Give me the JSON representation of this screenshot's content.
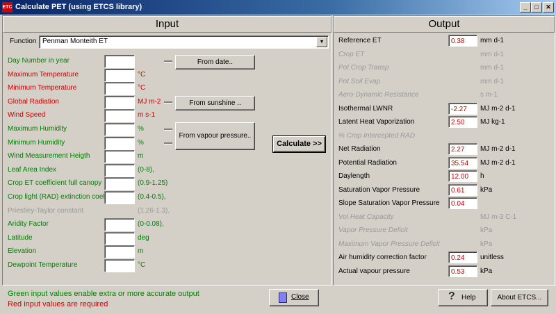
{
  "window": {
    "title": "Calculate PET (using ETCS library)",
    "icon_text": "ETC"
  },
  "input": {
    "header": "Input",
    "function_label": "Function",
    "function_value": "Penman Monteith ET",
    "rows": [
      {
        "label": "Day Number in year",
        "color": "#008000",
        "unit": ""
      },
      {
        "label": "Maximum Temperature",
        "color": "#cc0000",
        "unit": "°C"
      },
      {
        "label": "Minimum Temperature",
        "color": "#cc0000",
        "unit": "°C"
      },
      {
        "label": "Global Radiation",
        "color": "#cc0000",
        "unit": "MJ m-2"
      },
      {
        "label": "Wind Speed",
        "color": "#cc0000",
        "unit": "m s-1"
      },
      {
        "label": "Maximum Humidity",
        "color": "#008000",
        "unit": "%"
      },
      {
        "label": "Minimum Humidity",
        "color": "#008000",
        "unit": "%"
      },
      {
        "label": "Wind Measurement Heigth",
        "color": "#008000",
        "unit": "m"
      },
      {
        "label": "Leaf Area Index",
        "color": "#008000",
        "unit": "(0-8),"
      },
      {
        "label": "Crop ET coefficient full canopy",
        "color": "#008000",
        "unit": "(0.9-1.25)"
      },
      {
        "label": "Crop light (RAD) extinction coeff",
        "color": "#008000",
        "unit": "(0.4-0.5),"
      },
      {
        "label": "Priestley-Taylor constant",
        "color": "#999999",
        "unit": "(1.26-1.3),"
      },
      {
        "label": "Aridity Factor",
        "color": "#008000",
        "unit": "(0-0.08),"
      },
      {
        "label": "Latitude",
        "color": "#008000",
        "unit": "deg"
      },
      {
        "label": "Elevation",
        "color": "#008000",
        "unit": "m"
      },
      {
        "label": "Dewpoint Temperature",
        "color": "#008000",
        "unit": "°C"
      }
    ],
    "buttons": {
      "from_date": "From date..",
      "from_sunshine": "From sunshine ..",
      "from_vapour": "From vapour pressure..",
      "calculate": "Calculate >>"
    }
  },
  "output": {
    "header": "Output",
    "rows": [
      {
        "label": "Reference ET",
        "value": "0.38",
        "unit": "mm d-1",
        "active": true
      },
      {
        "label": "Crop ET",
        "value": "",
        "unit": "mm d-1",
        "active": false
      },
      {
        "label": "Pot Crop Transp",
        "value": "",
        "unit": "mm d-1",
        "active": false
      },
      {
        "label": "Pot Soil Evap",
        "value": "",
        "unit": "mm d-1",
        "active": false
      },
      {
        "label": "Aero-Dynamic Resistance",
        "value": "",
        "unit": "s m-1",
        "active": false
      },
      {
        "label": "Isothermal LWNR",
        "value": "-2.27",
        "unit": "MJ m-2 d-1",
        "active": true
      },
      {
        "label": "Latent Heat Vaporization",
        "value": "2.50",
        "unit": "MJ kg-1",
        "active": true
      },
      {
        "label": "% Crop Intercepted RAD",
        "value": "",
        "unit": "",
        "active": false
      },
      {
        "label": "Net Radiation",
        "value": "2.27",
        "unit": "MJ m-2 d-1",
        "active": true
      },
      {
        "label": "Potential Radiation",
        "value": "35.54",
        "unit": "MJ m-2 d-1",
        "active": true
      },
      {
        "label": "Daylength",
        "value": "12.00",
        "unit": "h",
        "active": true
      },
      {
        "label": "Saturation Vapor Pressure",
        "value": "0.61",
        "unit": "kPa",
        "active": true
      },
      {
        "label": "Slope Saturation Vapor Pressure",
        "value": "0.04",
        "unit": "",
        "active": true
      },
      {
        "label": "Vol Heat Capacity",
        "value": "",
        "unit": "MJ m-3 C-1",
        "active": false
      },
      {
        "label": "Vapor Pressure Deficit",
        "value": "",
        "unit": "kPa",
        "active": false
      },
      {
        "label": "Maximum Vapor Pressure Deficit",
        "value": "",
        "unit": "kPa",
        "active": false
      },
      {
        "label": "Air humidity correction factor",
        "value": "0.24",
        "unit": "unitless",
        "active": true
      },
      {
        "label": "Actual vapour pressure",
        "value": "0.53",
        "unit": "kPa",
        "active": true
      }
    ]
  },
  "footer": {
    "hint_green": "Green input values enable extra or more accurate output",
    "hint_red": "Red input values are required",
    "close": "Close",
    "help": "Help",
    "about": "About ETCS..."
  },
  "colors": {
    "titlebar": "#0a246a",
    "required": "#cc0000",
    "optional": "#008000",
    "disabled": "#999999"
  }
}
